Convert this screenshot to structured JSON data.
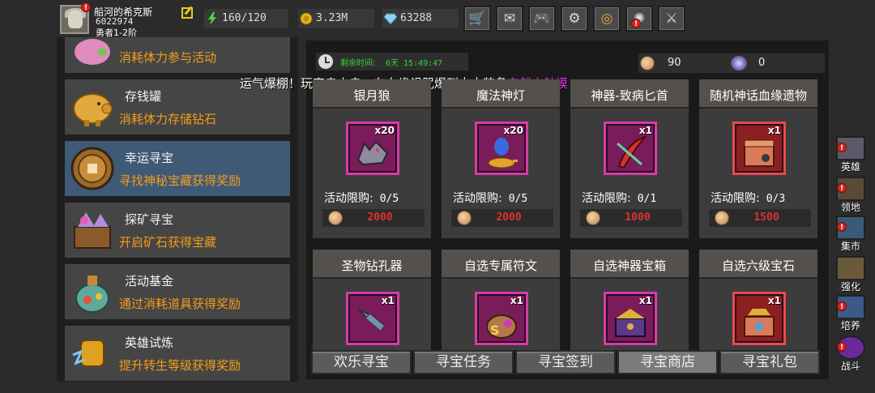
{
  "player": {
    "name": "船河的希克斯",
    "id": "6022974",
    "rank": "勇者1-2阶"
  },
  "resources": {
    "stamina": "160/120",
    "gold": "3.23M",
    "diamond": "63288"
  },
  "toolbar": [
    {
      "name": "shop",
      "glyph": "🛒"
    },
    {
      "name": "mail",
      "glyph": "✉"
    },
    {
      "name": "gamepad",
      "glyph": "🎮"
    },
    {
      "name": "settings",
      "glyph": "⚙"
    },
    {
      "name": "color-wheel",
      "glyph": "◎"
    },
    {
      "name": "event",
      "glyph": "✺"
    },
    {
      "name": "battle",
      "glyph": "⚔"
    }
  ],
  "sidebar": {
    "items": [
      {
        "title": "",
        "desc": "消耗体力参与活动"
      },
      {
        "title": "存钱罐",
        "desc": "消耗体力存储钻石"
      },
      {
        "title": "幸运寻宝",
        "desc": "寻找神秘宝藏获得奖励"
      },
      {
        "title": "探矿寻宝",
        "desc": "开启矿石获得宝藏"
      },
      {
        "title": "活动基金",
        "desc": "通过消耗道具获得奖励"
      },
      {
        "title": "英雄试炼",
        "desc": "提升转生等级获得奖励"
      }
    ]
  },
  "event": {
    "timer_label": "剩余时间:",
    "timer_value": "6天 15:49:47",
    "coins": "90",
    "gems": "0"
  },
  "marquee": {
    "text": "运气爆棚！玩家赤小赤，在血缘诅咒爆到太古装备",
    "highlight": "自然之触摸"
  },
  "shop": {
    "limit_label": "活动限购:",
    "items": [
      {
        "title": "银月狼",
        "qty": "x20",
        "limit": "0/5",
        "price": "2000"
      },
      {
        "title": "魔法神灯",
        "qty": "x20",
        "limit": "0/5",
        "price": "2000"
      },
      {
        "title": "神器-致病匕首",
        "qty": "x1",
        "limit": "0/1",
        "price": "1000"
      },
      {
        "title": "随机神话血缘遗物",
        "qty": "x1",
        "limit": "0/3",
        "price": "1500"
      },
      {
        "title": "圣物钻孔器",
        "qty": "x1"
      },
      {
        "title": "自选专属符文",
        "qty": "x1"
      },
      {
        "title": "自选神器宝箱",
        "qty": "x1"
      },
      {
        "title": "自选六级宝石",
        "qty": "x1"
      }
    ]
  },
  "tabs": [
    "欢乐寻宝",
    "寻宝任务",
    "寻宝签到",
    "寻宝商店",
    "寻宝礼包"
  ],
  "side_menu": [
    "英雄",
    "领地",
    "集市",
    "强化",
    "培养",
    "战斗"
  ],
  "colors": {
    "accent_orange": "#f39c1a",
    "price_red": "#e13131",
    "timer_green": "#36d43a",
    "highlight_magenta": "#e23cd7",
    "active_menu": "#3f5a77"
  }
}
